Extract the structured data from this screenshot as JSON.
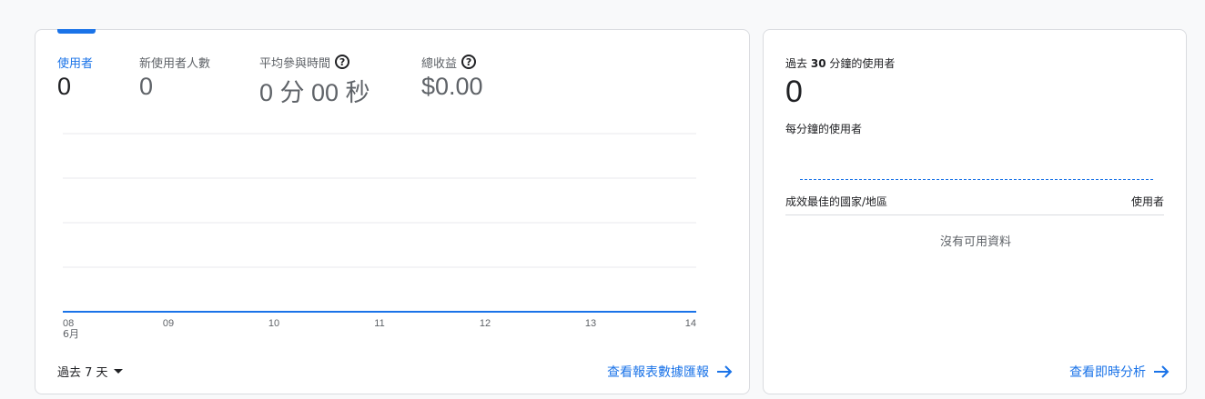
{
  "overview": {
    "metrics": [
      {
        "label": "使用者",
        "value": "0",
        "active": true,
        "help": false
      },
      {
        "label": "新使用者人數",
        "value": "0",
        "active": false,
        "help": false
      },
      {
        "label": "平均參與時間",
        "value": "0 分 00 秒",
        "active": false,
        "help": true
      },
      {
        "label": "總收益",
        "value": "$0.00",
        "active": false,
        "help": true
      }
    ],
    "period_label": "過去 7 天",
    "report_link": "查看報表數據匯報"
  },
  "chart_data": {
    "type": "line",
    "x": [
      "08",
      "09",
      "10",
      "11",
      "12",
      "13",
      "14"
    ],
    "x_month_label": "6月",
    "series": [
      {
        "values": [
          0,
          0,
          0,
          0,
          0,
          0,
          0
        ]
      }
    ],
    "grid": true,
    "line_color": "#1a73e8"
  },
  "realtime": {
    "title_prefix": "過去",
    "title_minutes": "30",
    "title_suffix": "分鐘的使用者",
    "value": "0",
    "per_minute_label": "每分鐘的使用者",
    "table_col_country": "成效最佳的國家/地區",
    "table_col_users": "使用者",
    "empty_text": "沒有可用資料",
    "link": "查看即時分析"
  },
  "colors": {
    "accent": "#1a73e8",
    "border": "#dadce0",
    "muted": "#5f6368"
  }
}
